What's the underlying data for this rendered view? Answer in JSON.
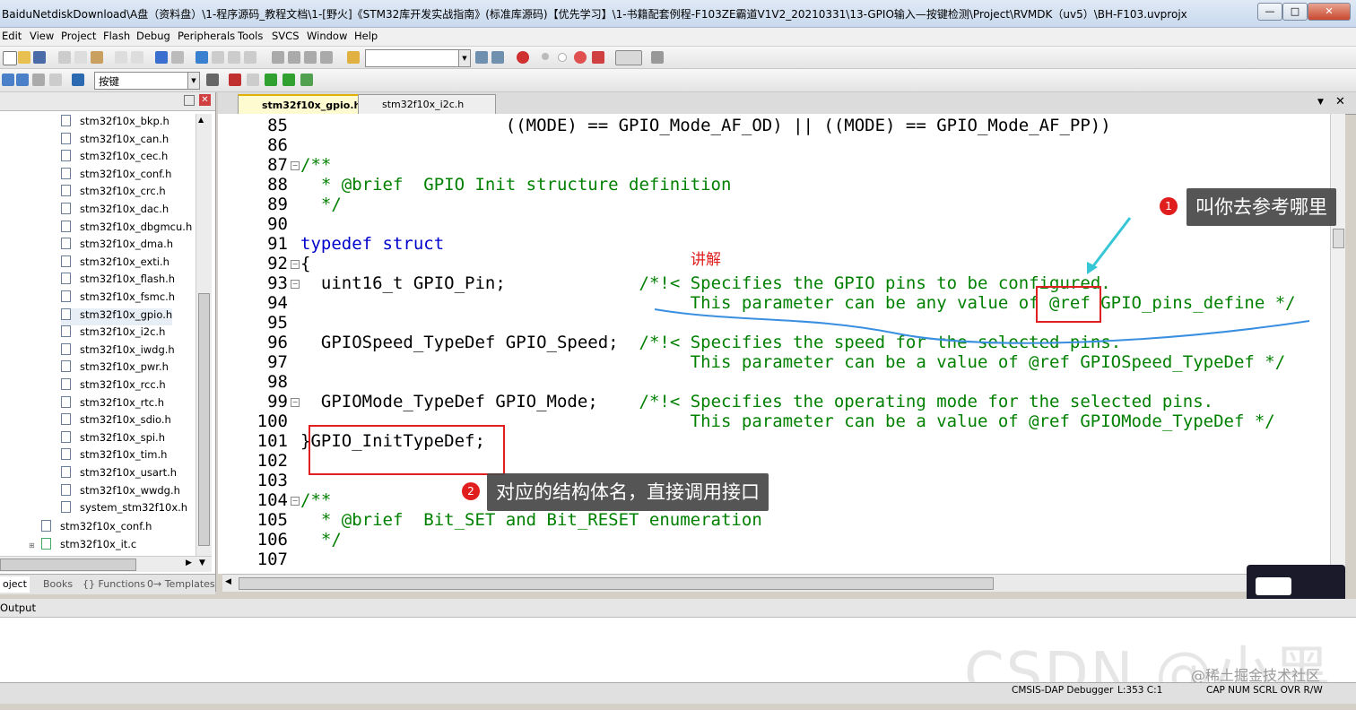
{
  "window": {
    "title": "BaiduNetdiskDownload\\A盘（资料盘）\\1-程序源码_教程文档\\1-[野火]《STM32库开发实战指南》(标准库源码)【优先学习】\\1-书籍配套例程-F103ZE霸道V1V2_20210331\\13-GPIO输入—按键检测\\Project\\RVMDK（uv5）\\BH-F103.uvprojx",
    "min": "—",
    "max": "□",
    "close": "✕"
  },
  "menu": [
    "Edit",
    "View",
    "Project",
    "Flash",
    "Debug",
    "Peripherals",
    "Tools",
    "SVCS",
    "Window",
    "Help"
  ],
  "toolbar": {
    "target_combo": "按键"
  },
  "project": {
    "files": [
      "stm32f10x_bkp.h",
      "stm32f10x_can.h",
      "stm32f10x_cec.h",
      "stm32f10x_conf.h",
      "stm32f10x_crc.h",
      "stm32f10x_dac.h",
      "stm32f10x_dbgmcu.h",
      "stm32f10x_dma.h",
      "stm32f10x_exti.h",
      "stm32f10x_flash.h",
      "stm32f10x_fsmc.h",
      "stm32f10x_gpio.h",
      "stm32f10x_i2c.h",
      "stm32f10x_iwdg.h",
      "stm32f10x_pwr.h",
      "stm32f10x_rcc.h",
      "stm32f10x_rtc.h",
      "stm32f10x_sdio.h",
      "stm32f10x_spi.h",
      "stm32f10x_tim.h",
      "stm32f10x_usart.h",
      "stm32f10x_wwdg.h",
      "system_stm32f10x.h"
    ],
    "parent_files": [
      "stm32f10x_conf.h",
      "stm32f10x_it.c"
    ],
    "tabs": [
      "oject",
      "Books",
      "{} Functions",
      "0→ Templates"
    ]
  },
  "editor": {
    "tabs": [
      "stm32f10x_gpio.h",
      "stm32f10x_i2c.h"
    ],
    "lines": [
      {
        "n": "85",
        "text": "                    ((MODE) == GPIO_Mode_AF_OD) || ((MODE) == GPIO_Mode_AF_PP))"
      },
      {
        "n": "86",
        "text": ""
      },
      {
        "n": "87",
        "text": "/**"
      },
      {
        "n": "88",
        "text": "  * @brief  GPIO Init structure definition"
      },
      {
        "n": "89",
        "text": "  */"
      },
      {
        "n": "90",
        "text": ""
      },
      {
        "n": "91",
        "text": "typedef struct"
      },
      {
        "n": "92",
        "text": "{"
      },
      {
        "n": "93",
        "text": "  uint16_t GPIO_Pin;             /*!< Specifies the GPIO pins to be configured."
      },
      {
        "n": "94",
        "text": "                                      This parameter can be any value of @ref GPIO_pins_define */"
      },
      {
        "n": "95",
        "text": ""
      },
      {
        "n": "96",
        "text": "  GPIOSpeed_TypeDef GPIO_Speed;  /*!< Specifies the speed for the selected pins."
      },
      {
        "n": "97",
        "text": "                                      This parameter can be a value of @ref GPIOSpeed_TypeDef */"
      },
      {
        "n": "98",
        "text": ""
      },
      {
        "n": "99",
        "text": "  GPIOMode_TypeDef GPIO_Mode;    /*!< Specifies the operating mode for the selected pins."
      },
      {
        "n": "100",
        "text": "                                      This parameter can be a value of @ref GPIOMode_TypeDef */"
      },
      {
        "n": "101",
        "text": "}GPIO_InitTypeDef;"
      },
      {
        "n": "102",
        "text": ""
      },
      {
        "n": "103",
        "text": ""
      },
      {
        "n": "104",
        "text": "/**"
      },
      {
        "n": "105",
        "text": "  * @brief  Bit_SET and Bit_RESET enumeration"
      },
      {
        "n": "106",
        "text": "  */"
      },
      {
        "n": "107",
        "text": ""
      }
    ]
  },
  "annotations": {
    "badge1": "1",
    "bubble1": "叫你去参考哪里",
    "explain_label": "讲解",
    "badge2": "2",
    "bubble2": "对应的结构体名，直接调用接口"
  },
  "output": {
    "title": "Output"
  },
  "status": {
    "debugger": "CMSIS-DAP Debugger",
    "position": "L:353 C:1",
    "flags": "CAP NUM SCRL OVR R/W"
  },
  "watermark": "CSDN @小黑",
  "watermark2": "@稀土掘金技术社区",
  "colors": {
    "keyword": "#0000cc",
    "comment": "#008000",
    "annotation_red": "#e02020",
    "ink_blue": "#3a8fe0"
  }
}
